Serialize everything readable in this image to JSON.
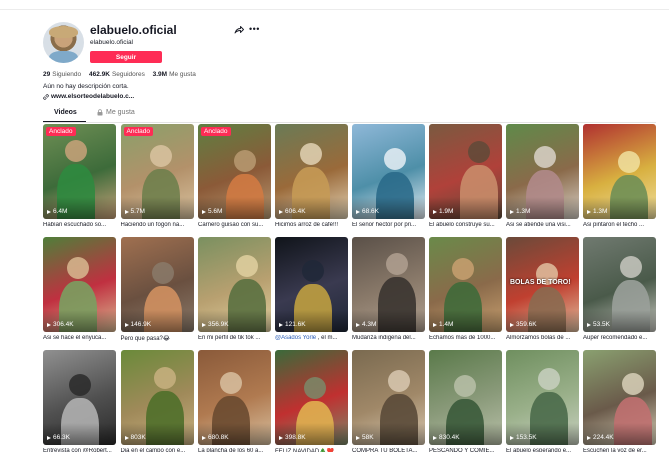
{
  "profile": {
    "username": "elabuelo.oficial",
    "nickname": "elabuelo.oficial",
    "follow_label": "Seguir",
    "stats": {
      "following_count": "29",
      "following_label": "Siguiendo",
      "followers_count": "462.9K",
      "followers_label": "Seguidores",
      "likes_count": "3.9M",
      "likes_label": "Me gusta"
    },
    "bio": "Aún no hay descripción corta.",
    "link": "www.elsorteodelabuelo.c..."
  },
  "tabs": {
    "videos": "Videos",
    "liked": "Me gusta"
  },
  "icons": {
    "share": "share-arrow-icon",
    "more": "more-dots-icon",
    "link": "link-icon",
    "lock": "lock-icon",
    "play": "play-icon"
  },
  "colors": {
    "accent": "#fe2c55",
    "mention": "#2b5db8"
  },
  "videos": [
    {
      "pinned": "Anclado",
      "views": "6.4M",
      "caption": "Habían escuchado so..."
    },
    {
      "pinned": "Anclado",
      "views": "5.7M",
      "caption": "Haciendo un fogon na..."
    },
    {
      "pinned": "Anclado",
      "views": "5.6M",
      "caption": "Carnero guisao con su..."
    },
    {
      "pinned": "",
      "views": "606.4K",
      "caption": "Hicimos arroz de café!!!"
    },
    {
      "pinned": "",
      "views": "68.6K",
      "caption": "El señor hector por pri..."
    },
    {
      "pinned": "",
      "views": "1.9M",
      "caption": "El abuelo construye su..."
    },
    {
      "pinned": "",
      "views": "1.3M",
      "caption": "Asi se atiende una visi..."
    },
    {
      "pinned": "",
      "views": "1.3M",
      "caption": "Asi pintaron el techo ..."
    },
    {
      "pinned": "",
      "views": "306.4K",
      "caption": "Asi se hace el enyuca..."
    },
    {
      "pinned": "",
      "views": "146.9K",
      "caption": "Pero que pasa?😂"
    },
    {
      "pinned": "",
      "views": "356.9K",
      "caption": "En mi perfil de tik tok ..."
    },
    {
      "pinned": "",
      "views": "121.6K",
      "caption_mention": "@Asados Yorle",
      "caption": " , el m..."
    },
    {
      "pinned": "",
      "views": "4.3M",
      "caption": "Mudanza indigena del..."
    },
    {
      "pinned": "",
      "views": "1.4M",
      "caption": "Echamos mas de 1000..."
    },
    {
      "pinned": "",
      "views": "359.6K",
      "caption": "Almorzamos bolas de ...",
      "overlay": "BOLAS DE TORO!"
    },
    {
      "pinned": "",
      "views": "53.5K",
      "caption": "Auper recomendado e..."
    },
    {
      "pinned": "",
      "views": "66.3K",
      "caption": "Entrevista con @Robert..."
    },
    {
      "pinned": "",
      "views": "803K",
      "caption": "Dia en el campo con e..."
    },
    {
      "pinned": "",
      "views": "680.8K",
      "caption": "La plancha de los 60 a..."
    },
    {
      "pinned": "",
      "views": "398.8K",
      "caption": "FELIZ NAVIDAD🎄❤️"
    },
    {
      "pinned": "",
      "views": "58K",
      "caption": "COMPRA TU BOLETA..."
    },
    {
      "pinned": "",
      "views": "830.4K",
      "caption": "PESCANDO Y COMIE..."
    },
    {
      "pinned": "",
      "views": "153.5K",
      "caption": "El abuelo esperando e..."
    },
    {
      "pinned": "",
      "views": "224.4K",
      "caption": "Escuchen la voz de er..."
    }
  ]
}
